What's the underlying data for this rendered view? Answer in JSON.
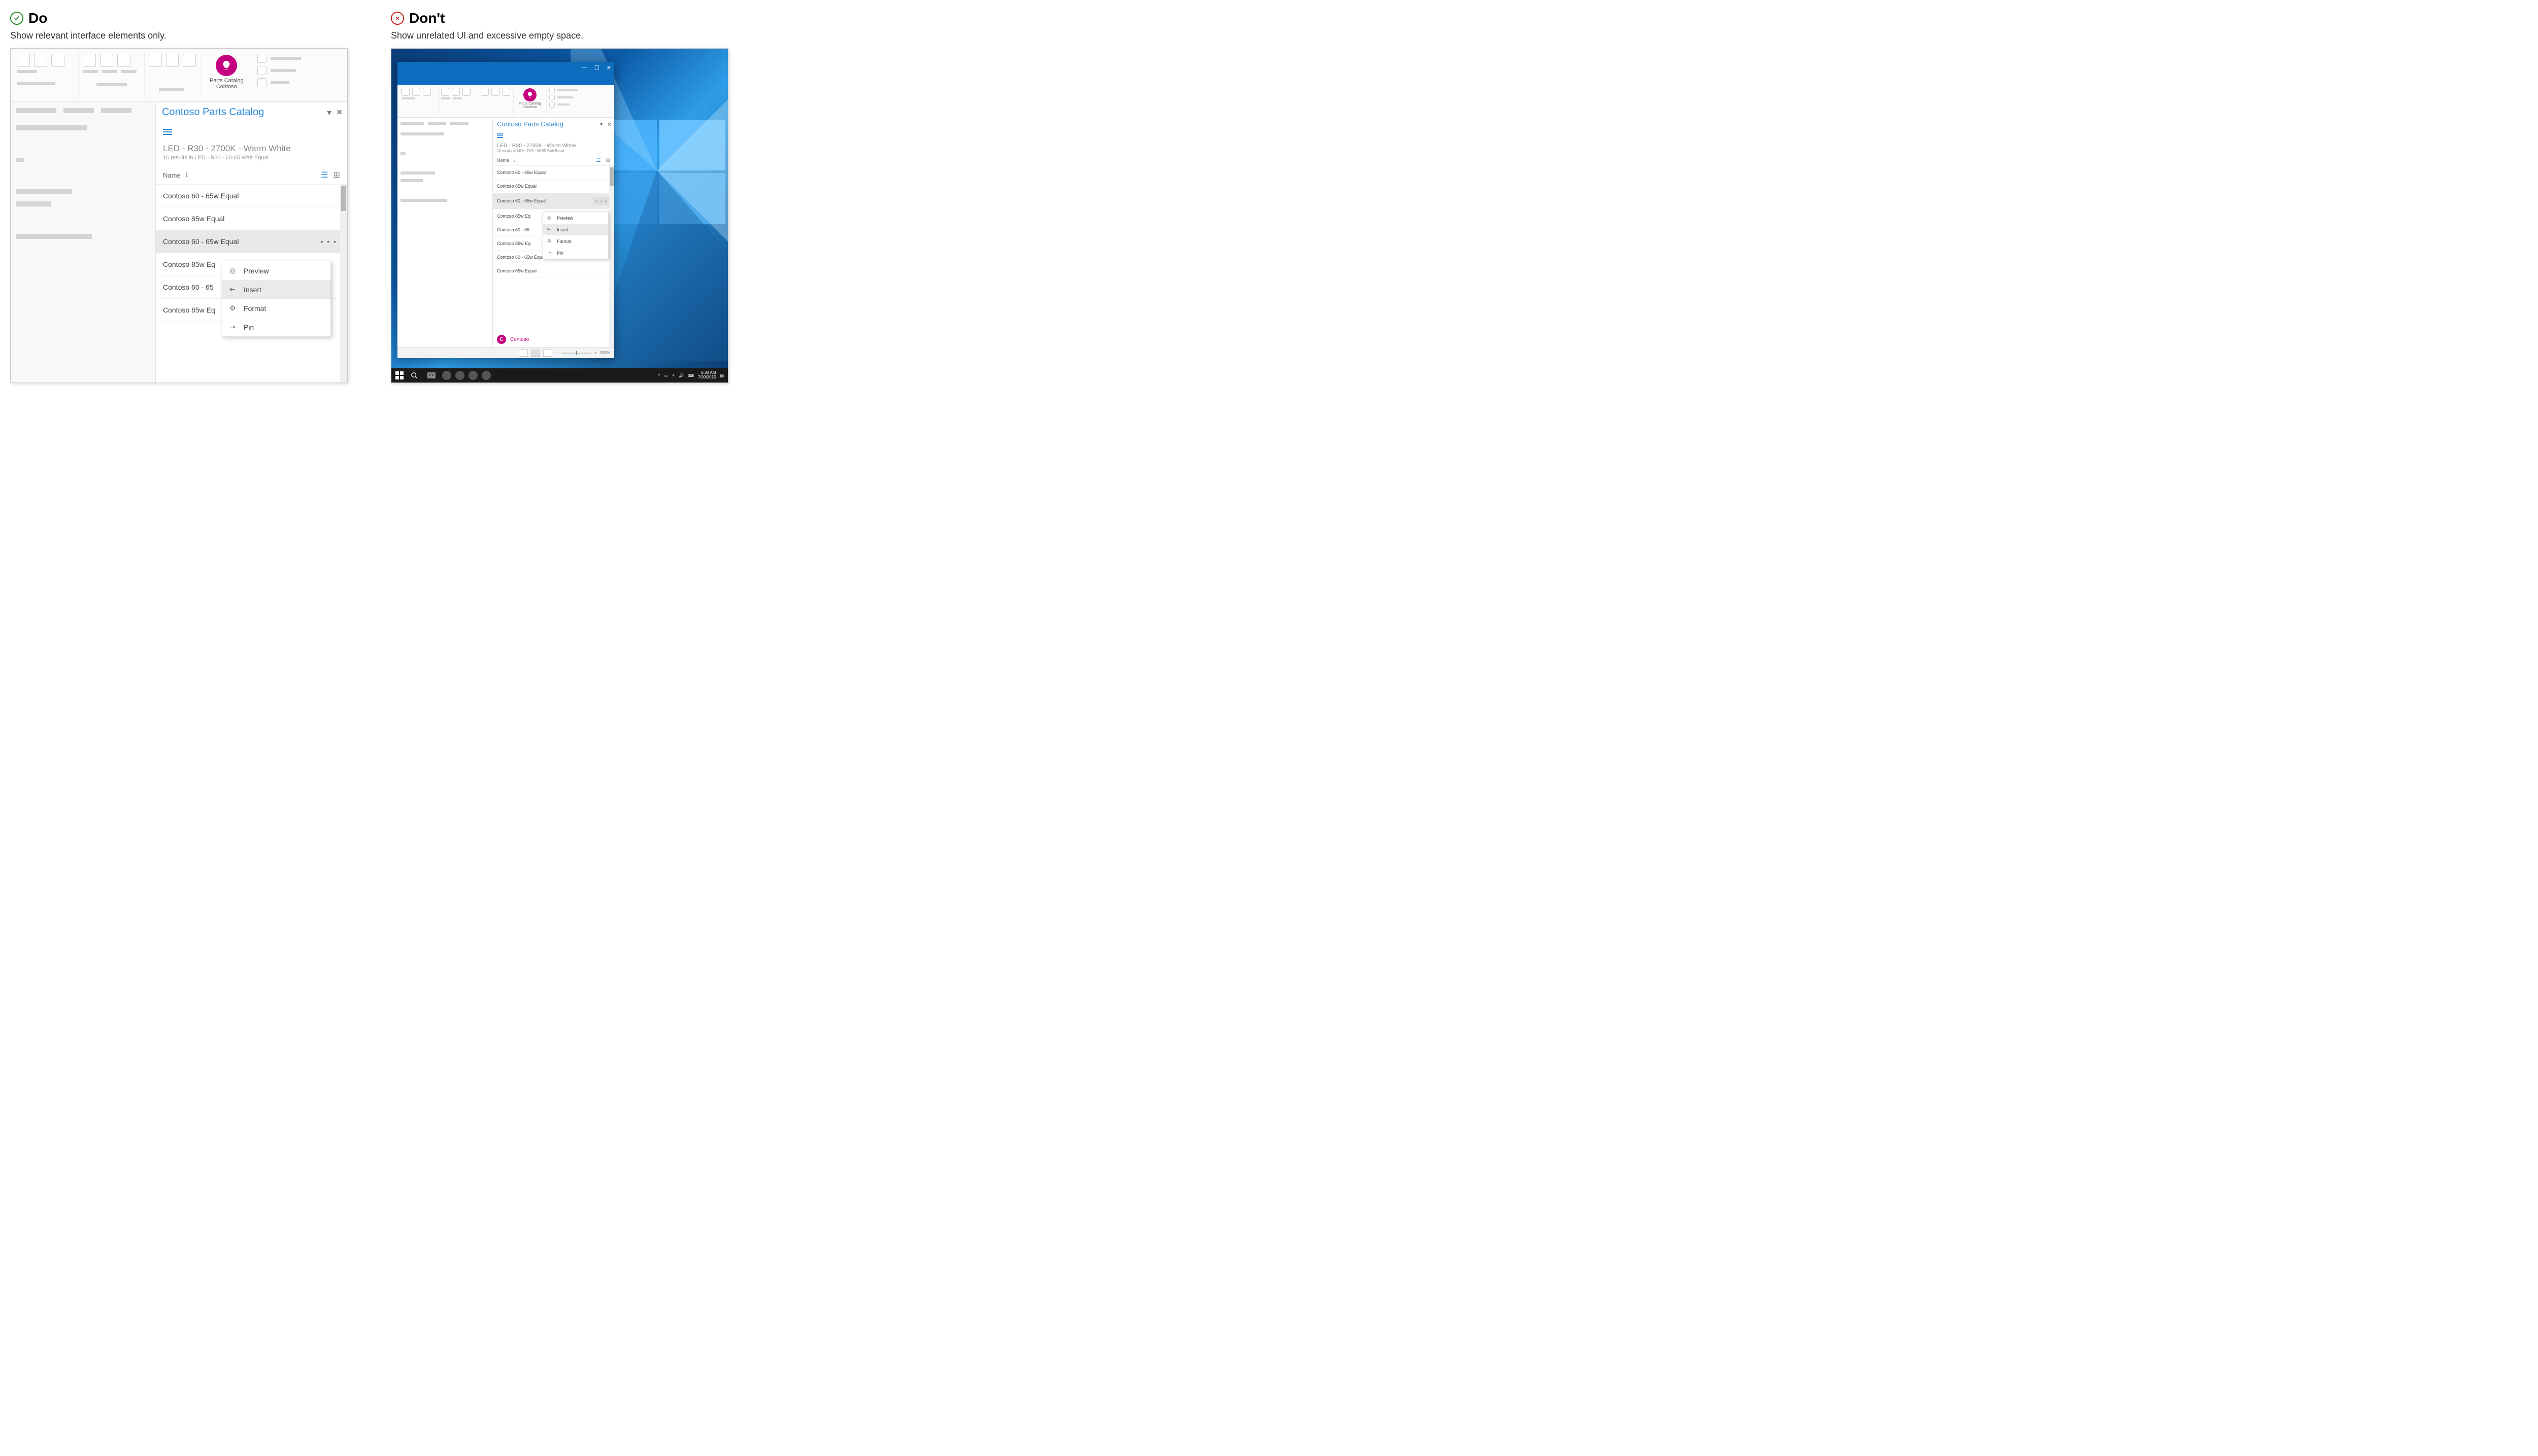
{
  "do": {
    "heading": "Do",
    "subtitle": "Show relevant interface elements only.",
    "ribbon": {
      "catalog_l1": "Parts Catalog",
      "catalog_l2": "Contoso"
    },
    "pane": {
      "title": "Contoso Parts Catalog",
      "breadcrumb": "LED - R30 - 2700K - Warm White",
      "resultcount": "16 results in LED - R30 - 60-65 Watt Equal",
      "name_col": "Name",
      "items": [
        "Contoso 60 - 65w Equal",
        "Contoso 85w Equal",
        "Contoso 60 - 65w Equal",
        "Contoso 85w Eq",
        "Contoso 60 - 65",
        "Contoso 85w Eq"
      ],
      "menu": {
        "preview": "Preview",
        "insert": "Insert",
        "format": "Format",
        "pin": "Pin"
      }
    }
  },
  "dont": {
    "heading": "Don't",
    "subtitle": "Show unrelated UI and excessive empty space.",
    "ribbon": {
      "catalog_l1": "Parts Catalog",
      "catalog_l2": "Contoso"
    },
    "pane": {
      "title": "Contoso Parts Catalog",
      "breadcrumb": "LED - R30 - 2700K - Warm White",
      "resultcount": "16 results in LED - R30 - 60-65 Watt Equal",
      "name_col": "Name",
      "items": [
        "Contoso 60 - 65w Equal",
        "Contoso 85w Equal",
        "Contoso 60 - 65w Equal",
        "Contoso 85w Eq",
        "Contoso 60 - 65",
        "Contoso 85w Eq",
        "Contoso 60 - 65w Equal",
        "Contoso 85w Equal"
      ],
      "menu": {
        "preview": "Preview",
        "insert": "Insert",
        "format": "Format",
        "pin": "Pin"
      },
      "brand_initial": "C",
      "brand_name": "Contoso"
    },
    "status": {
      "zoom": "100%"
    },
    "taskbar": {
      "time": "6:30 AM",
      "date": "7/30/2015"
    }
  }
}
